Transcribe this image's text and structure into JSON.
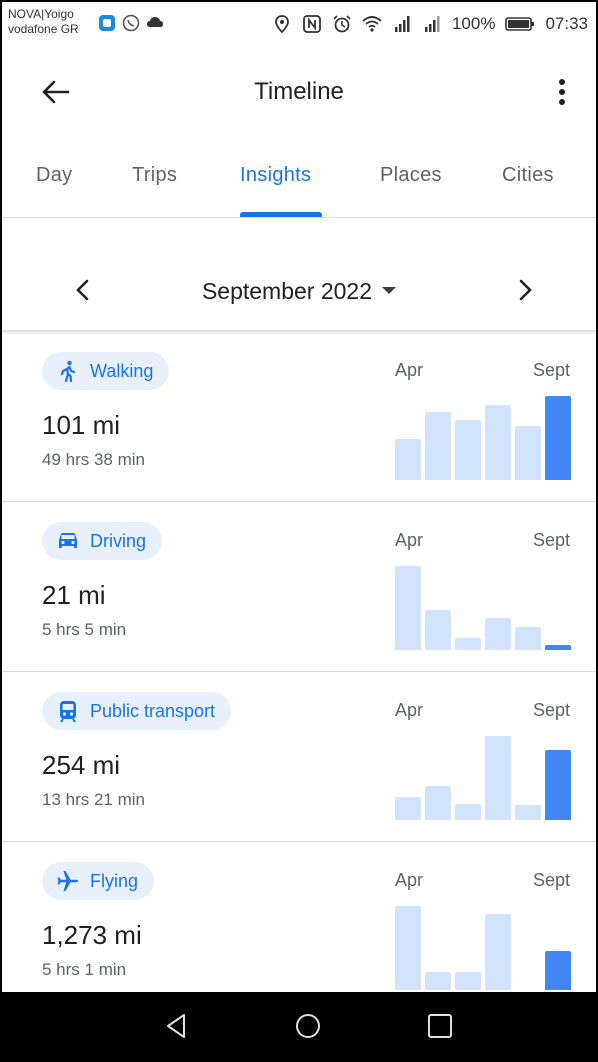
{
  "status_bar": {
    "carrier_top": "NOVA|Yoigo",
    "carrier_bottom": "vodafone GR",
    "battery": "100%",
    "time": "07:33"
  },
  "app_bar": {
    "title": "Timeline",
    "back_icon": "arrow-back-icon",
    "more_icon": "more-vert-icon"
  },
  "tabs": [
    {
      "label": "Day",
      "active": false
    },
    {
      "label": "Trips",
      "active": false
    },
    {
      "label": "Insights",
      "active": true
    },
    {
      "label": "Places",
      "active": false
    },
    {
      "label": "Cities",
      "active": false
    }
  ],
  "month_selector": {
    "label": "September 2022",
    "prev_icon": "chevron-left-icon",
    "next_icon": "chevron-right-icon"
  },
  "colors": {
    "accent": "#1a73e8",
    "chip_bg": "#e8f0fe",
    "bar_past": "#d2e3fc",
    "bar_current": "#4285f4"
  },
  "cards": [
    {
      "label": "Walking",
      "icon": "walking-icon",
      "distance": "101 mi",
      "duration": "49 hrs 38 min",
      "from": "Apr",
      "to": "Sept",
      "bar_levels": [
        0.49,
        0.81,
        0.71,
        0.89,
        0.64,
        1.0
      ]
    },
    {
      "label": "Driving",
      "icon": "car-icon",
      "distance": "21 mi",
      "duration": "5 hrs 5 min",
      "from": "Apr",
      "to": "Sept",
      "bar_levels": [
        1.0,
        0.48,
        0.14,
        0.38,
        0.27,
        0.06
      ]
    },
    {
      "label": "Public transport",
      "icon": "train-icon",
      "distance": "254 mi",
      "duration": "13 hrs 21 min",
      "from": "Apr",
      "to": "Sept",
      "bar_levels": [
        0.27,
        0.41,
        0.19,
        1.0,
        0.18,
        0.83
      ]
    },
    {
      "label": "Flying",
      "icon": "airplane-icon",
      "distance": "1,273 mi",
      "duration": "5 hrs 1 min",
      "from": "Apr",
      "to": "Sept",
      "bar_levels": [
        1.0,
        0.22,
        0.21,
        0.91,
        0.0,
        0.47
      ]
    }
  ],
  "nav_bar": {
    "back_icon": "nav-back-icon",
    "home_icon": "nav-home-icon",
    "recents_icon": "nav-recents-icon"
  }
}
